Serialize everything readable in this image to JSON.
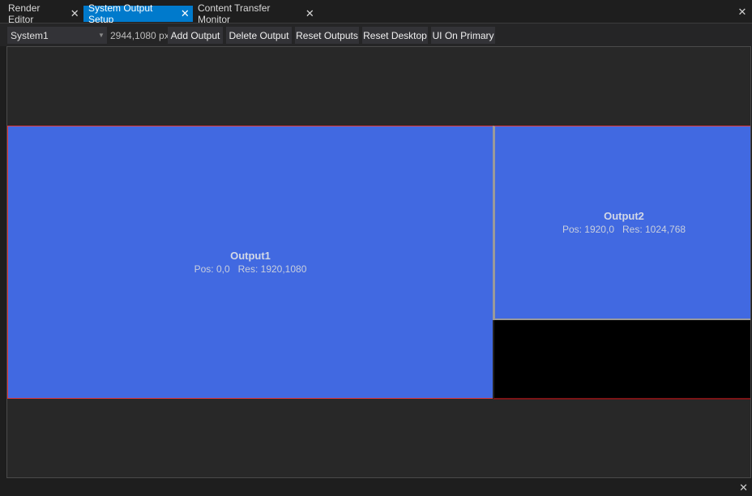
{
  "tabs": [
    {
      "label": "Render Editor",
      "active": false
    },
    {
      "label": "System Output Setup",
      "active": true
    },
    {
      "label": "Content Transfer Monitor",
      "active": false
    }
  ],
  "close_glyph": "✕",
  "toolbar": {
    "system_select": "System1",
    "desktop_size": "2944,1080 px",
    "buttons": {
      "add_output": "Add Output",
      "delete_output": "Delete Output",
      "reset_outputs": "Reset Outputs",
      "reset_desktop": "Reset Desktop",
      "ui_on_primary": "UI On Primary"
    }
  },
  "outputs": [
    {
      "name": "Output1",
      "info": "Pos: 0,0   Res: 1920,1080"
    },
    {
      "name": "Output2",
      "info": "Pos: 1920,0   Res: 1024,768"
    }
  ],
  "colors": {
    "accent": "#007acc",
    "output_fill": "#4169e1",
    "output_border": "#e0393e"
  }
}
